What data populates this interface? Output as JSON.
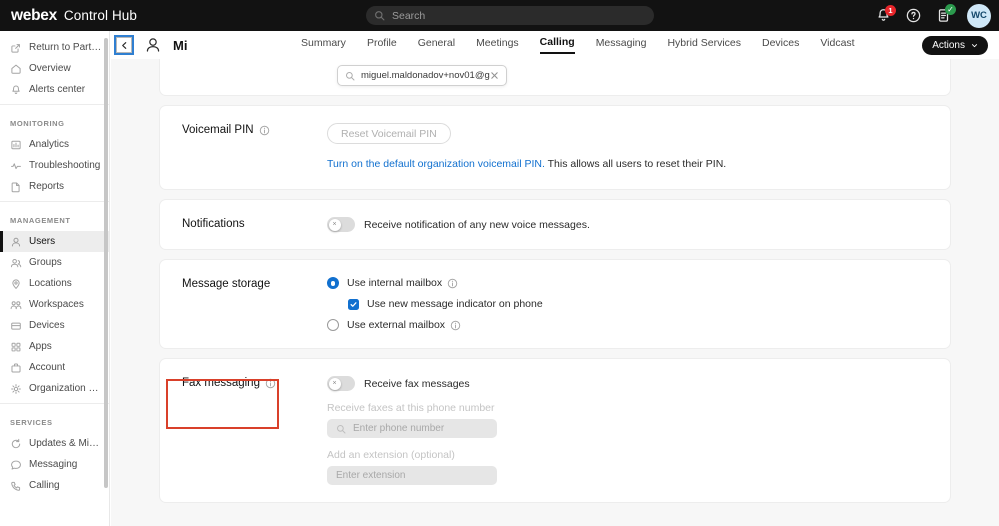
{
  "topbar": {
    "brand_primary": "webex",
    "brand_secondary": "Control Hub",
    "search_placeholder": "Search",
    "notification_count": "1",
    "avatar_initials": "WC",
    "icons": {
      "search": "search-icon",
      "bell": "bell-icon",
      "help": "help-circle-icon",
      "tasks": "tasks-icon",
      "task_status": "check-icon"
    },
    "accent_badge_color": "#e8262b",
    "status_badge_color": "#2b9a4d"
  },
  "sidebar": {
    "groups": [
      {
        "header": "",
        "items": [
          {
            "label": "Return to Partner ...",
            "icon": "external-link-icon",
            "active": false
          },
          {
            "label": "Overview",
            "icon": "home-icon",
            "active": false
          },
          {
            "label": "Alerts center",
            "icon": "bell-icon",
            "active": false
          }
        ]
      },
      {
        "header": "MONITORING",
        "items": [
          {
            "label": "Analytics",
            "icon": "bar-chart-icon",
            "active": false
          },
          {
            "label": "Troubleshooting",
            "icon": "pulse-icon",
            "active": false
          },
          {
            "label": "Reports",
            "icon": "document-icon",
            "active": false
          }
        ]
      },
      {
        "header": "MANAGEMENT",
        "items": [
          {
            "label": "Users",
            "icon": "user-icon",
            "active": true
          },
          {
            "label": "Groups",
            "icon": "users-icon",
            "active": false
          },
          {
            "label": "Locations",
            "icon": "map-pin-icon",
            "active": false
          },
          {
            "label": "Workspaces",
            "icon": "workspace-icon",
            "active": false
          },
          {
            "label": "Devices",
            "icon": "device-icon",
            "active": false
          },
          {
            "label": "Apps",
            "icon": "apps-grid-icon",
            "active": false
          },
          {
            "label": "Account",
            "icon": "briefcase-icon",
            "active": false
          },
          {
            "label": "Organization Setti...",
            "icon": "gear-icon",
            "active": false
          }
        ]
      },
      {
        "header": "SERVICES",
        "items": [
          {
            "label": "Updates & Migrati...",
            "icon": "refresh-icon",
            "active": false
          },
          {
            "label": "Messaging",
            "icon": "chat-bubble-icon",
            "active": false
          },
          {
            "label": "Calling",
            "icon": "phone-icon",
            "active": false
          }
        ]
      }
    ]
  },
  "userbar": {
    "back_icon": "chevron-left-icon",
    "avatar_icon": "user-avatar-icon",
    "user_name": "Mi",
    "actions_label": "Actions",
    "actions_chevron": "chevron-down-icon",
    "tabs": [
      {
        "label": "Summary",
        "active": false
      },
      {
        "label": "Profile",
        "active": false
      },
      {
        "label": "General",
        "active": false
      },
      {
        "label": "Meetings",
        "active": false
      },
      {
        "label": "Calling",
        "active": true
      },
      {
        "label": "Messaging",
        "active": false
      },
      {
        "label": "Hybrid Services",
        "active": false
      },
      {
        "label": "Devices",
        "active": false
      },
      {
        "label": "Vidcast",
        "active": false
      }
    ]
  },
  "email_search": {
    "icon": "search-icon",
    "value": "miguel.maldonadov+nov01@g",
    "clear_icon": "close-icon"
  },
  "cards": {
    "voicemail_pin": {
      "label": "Voicemail PIN",
      "info_icon": "info-icon",
      "reset_button": "Reset Voicemail PIN",
      "link_text": "Turn on the default organization voicemail PIN.",
      "link_suffix": " This allows all users to reset their PIN.",
      "link_color": "#1170cf"
    },
    "notifications": {
      "label": "Notifications",
      "toggle_state": "off",
      "toggle_knob_glyph": "×",
      "toggle_text": "Receive notification of any new voice messages."
    },
    "message_storage": {
      "label": "Message storage",
      "options": [
        {
          "label": "Use internal mailbox",
          "selected": true,
          "info_icon": "info-icon"
        },
        {
          "label": "Use external mailbox",
          "selected": false,
          "info_icon": "info-icon"
        }
      ],
      "checkbox": {
        "label": "Use new message indicator on phone",
        "checked": true
      },
      "accent_color": "#1170cf"
    },
    "fax_messaging": {
      "label": "Fax messaging",
      "info_icon": "info-icon",
      "toggle_state": "off",
      "toggle_knob_glyph": "×",
      "toggle_text": "Receive fax messages",
      "phone_field_label": "Receive faxes at this phone number",
      "phone_field_placeholder": "Enter phone number",
      "phone_field_icon": "search-icon",
      "extension_field_label": "Add an extension (optional)",
      "extension_field_placeholder": "Enter extension",
      "annotation_color": "#d9402a"
    }
  }
}
